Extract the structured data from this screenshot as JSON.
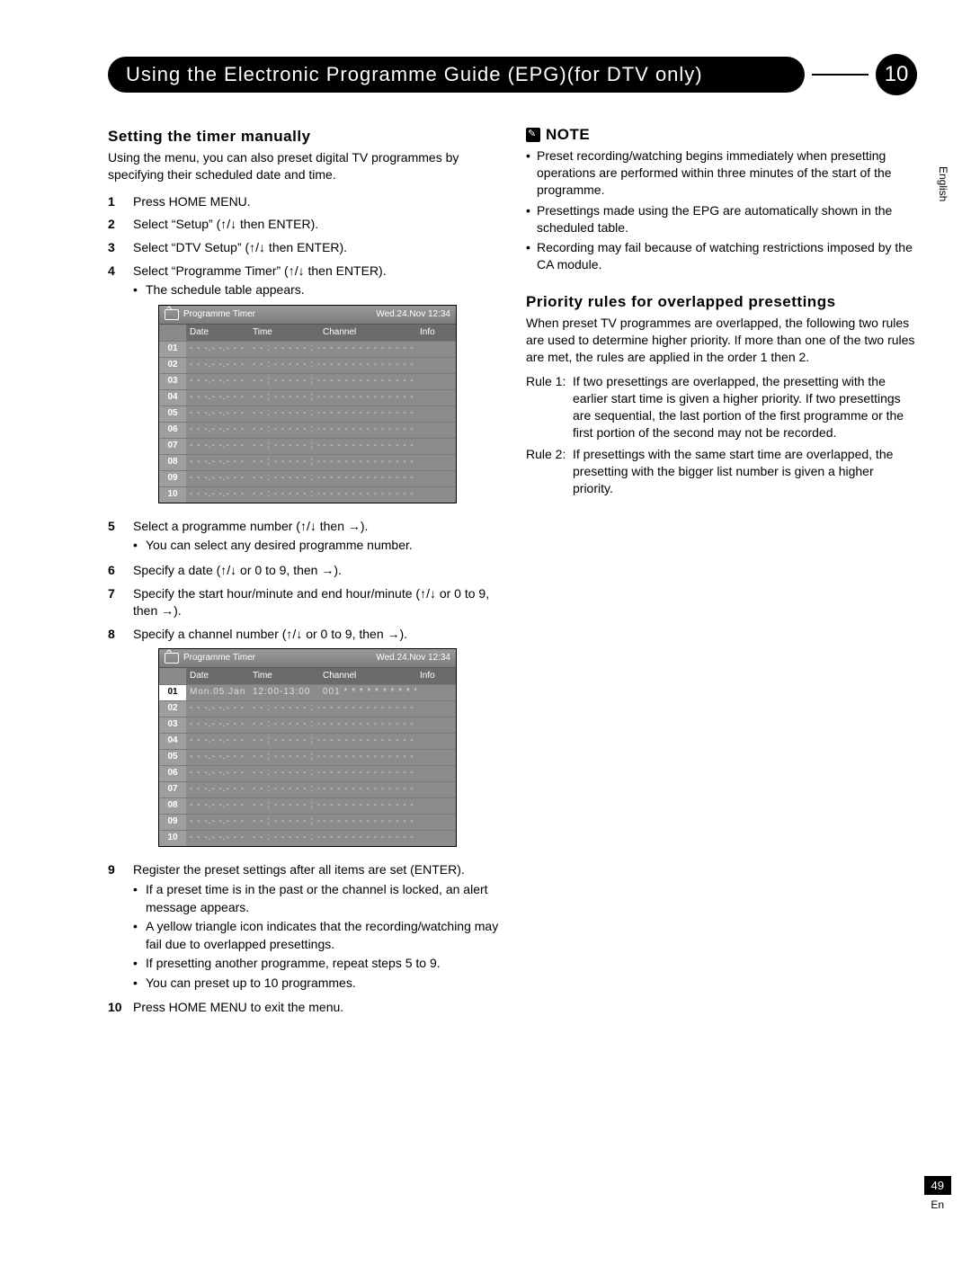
{
  "chapter": {
    "title": "Using the Electronic Programme Guide (EPG)(for DTV only)",
    "number": "10"
  },
  "left": {
    "heading": "Setting the timer manually",
    "intro": "Using the menu, you can also preset digital TV programmes by specifying their scheduled date and time.",
    "steps": [
      {
        "text": "Press HOME MENU."
      },
      {
        "text": "Select “Setup” (↑/↓ then ENTER)."
      },
      {
        "text": "Select “DTV Setup” (↑/↓ then ENTER)."
      },
      {
        "text": "Select “Programme Timer” (↑/↓ then ENTER).",
        "sub": [
          "The schedule table appears."
        ]
      },
      {
        "text": "Select a programme number (↑/↓ then →).",
        "sub": [
          "You can select any desired programme number."
        ]
      },
      {
        "text": "Specify a date (↑/↓ or 0 to 9, then →)."
      },
      {
        "text": "Specify the start hour/minute and end hour/minute (↑/↓ or 0 to 9, then →)."
      },
      {
        "text": "Specify a channel number (↑/↓ or 0 to 9, then →)."
      },
      {
        "text": "Register the preset settings after all items are set (ENTER).",
        "sub": [
          "If a preset time is in the past or the channel is locked, an alert message appears.",
          "A yellow triangle icon indicates that the recording/watching may fail due to overlapped presettings.",
          "If presetting another programme, repeat steps 5 to 9.",
          "You can preset up to 10 programmes."
        ]
      },
      {
        "text": "Press HOME MENU to exit the menu."
      }
    ],
    "table": {
      "title": "Programme Timer",
      "datetime": "Wed.24.Nov 12:34",
      "cols": {
        "date": "Date",
        "time": "Time",
        "channel": "Channel",
        "info": "Info"
      },
      "rowsA": [
        {
          "n": "01",
          "date": "- - -.- -.- - -",
          "time": "- - : - - - - - : - -",
          "ch": "- - -  - - - - - - - - - - - - - - - - - - - - - - -"
        },
        {
          "n": "02",
          "date": "- - -.- -.- - -",
          "time": "- - : - - - - - : - -",
          "ch": "- - -  - - - - - - - - - - - - - - - - - - - - - - -"
        },
        {
          "n": "03",
          "date": "- - -.- -.- - -",
          "time": "- - : - - - - - : - -",
          "ch": "- - -  - - - - - - - - - - - - - - - - - - - - - - -"
        },
        {
          "n": "04",
          "date": "- - -.- -.- - -",
          "time": "- - : - - - - - : - -",
          "ch": "- - -  - - - - - - - - - - - - - - - - - - - - - - -"
        },
        {
          "n": "05",
          "date": "- - -.- -.- - -",
          "time": "- - : - - - - - : - -",
          "ch": "- - -  - - - - - - - - - - - - - - - - - - - - - - -"
        },
        {
          "n": "06",
          "date": "- - -.- -.- - -",
          "time": "- - : - - - - - : - -",
          "ch": "- - -  - - - - - - - - - - - - - - - - - - - - - - -"
        },
        {
          "n": "07",
          "date": "- - -.- -.- - -",
          "time": "- - : - - - - - : - -",
          "ch": "- - -  - - - - - - - - - - - - - - - - - - - - - - -"
        },
        {
          "n": "08",
          "date": "- - -.- -.- - -",
          "time": "- - : - - - - - : - -",
          "ch": "- - -  - - - - - - - - - - - - - - - - - - - - - - -"
        },
        {
          "n": "09",
          "date": "- - -.- -.- - -",
          "time": "- - : - - - - - : - -",
          "ch": "- - -  - - - - - - - - - - - - - - - - - - - - - - -"
        },
        {
          "n": "10",
          "date": "- - -.- -.- - -",
          "time": "- - : - - - - - : - -",
          "ch": "- - -  - - - - - - - - - - - - - - - - - - - - - - -"
        }
      ],
      "rowsB": [
        {
          "n": "01",
          "date": "Mon.05.Jan",
          "time": "12:00-13:00",
          "ch": "001  * * * * * * * * * * * *",
          "sel": true
        },
        {
          "n": "02",
          "date": "- - -.- -.- - -",
          "time": "- - : - - - - - : - -",
          "ch": "- - -  - - - - - - - - - - - - - - - - - - - - - - -"
        },
        {
          "n": "03",
          "date": "- - -.- -.- - -",
          "time": "- - : - - - - - : - -",
          "ch": "- - -  - - - - - - - - - - - - - - - - - - - - - - -"
        },
        {
          "n": "04",
          "date": "- - -.- -.- - -",
          "time": "- - : - - - - - : - -",
          "ch": "- - -  - - - - - - - - - - - - - - - - - - - - - - -"
        },
        {
          "n": "05",
          "date": "- - -.- -.- - -",
          "time": "- - : - - - - - : - -",
          "ch": "- - -  - - - - - - - - - - - - - - - - - - - - - - -"
        },
        {
          "n": "06",
          "date": "- - -.- -.- - -",
          "time": "- - : - - - - - : - -",
          "ch": "- - -  - - - - - - - - - - - - - - - - - - - - - - -"
        },
        {
          "n": "07",
          "date": "- - -.- -.- - -",
          "time": "- - : - - - - - : - -",
          "ch": "- - -  - - - - - - - - - - - - - - - - - - - - - - -"
        },
        {
          "n": "08",
          "date": "- - -.- -.- - -",
          "time": "- - : - - - - - : - -",
          "ch": "- - -  - - - - - - - - - - - - - - - - - - - - - - -"
        },
        {
          "n": "09",
          "date": "- - -.- -.- - -",
          "time": "- - : - - - - - : - -",
          "ch": "- - -  - - - - - - - - - - - - - - - - - - - - - - -"
        },
        {
          "n": "10",
          "date": "- - -.- -.- - -",
          "time": "- - : - - - - - : - -",
          "ch": "- - -  - - - - - - - - - - - - - - - - - - - - - - -"
        }
      ]
    }
  },
  "right": {
    "note_label": "NOTE",
    "notes": [
      "Preset recording/watching begins immediately when presetting operations are performed within three minutes of the start of the programme.",
      "Presettings made using the EPG are automatically shown in the scheduled table.",
      "Recording may fail because of watching restrictions imposed by the CA module."
    ],
    "priority_heading": "Priority rules for overlapped presettings",
    "priority_intro": "When preset TV programmes are overlapped, the following two rules are used to determine higher priority. If more than one of the two rules are met, the rules are applied in the order 1 then 2.",
    "rule1_label": "Rule 1:",
    "rule1": "If two presettings are overlapped, the presetting with the earlier start time is given a higher priority. If two presettings are sequential, the last portion of the first programme or the first portion of the second may not be recorded.",
    "rule2_label": "Rule 2:",
    "rule2": "If presettings with the same start time are overlapped, the presetting with the bigger list number is given a higher priority."
  },
  "margin": {
    "lang": "English",
    "page": "49",
    "en": "En"
  }
}
